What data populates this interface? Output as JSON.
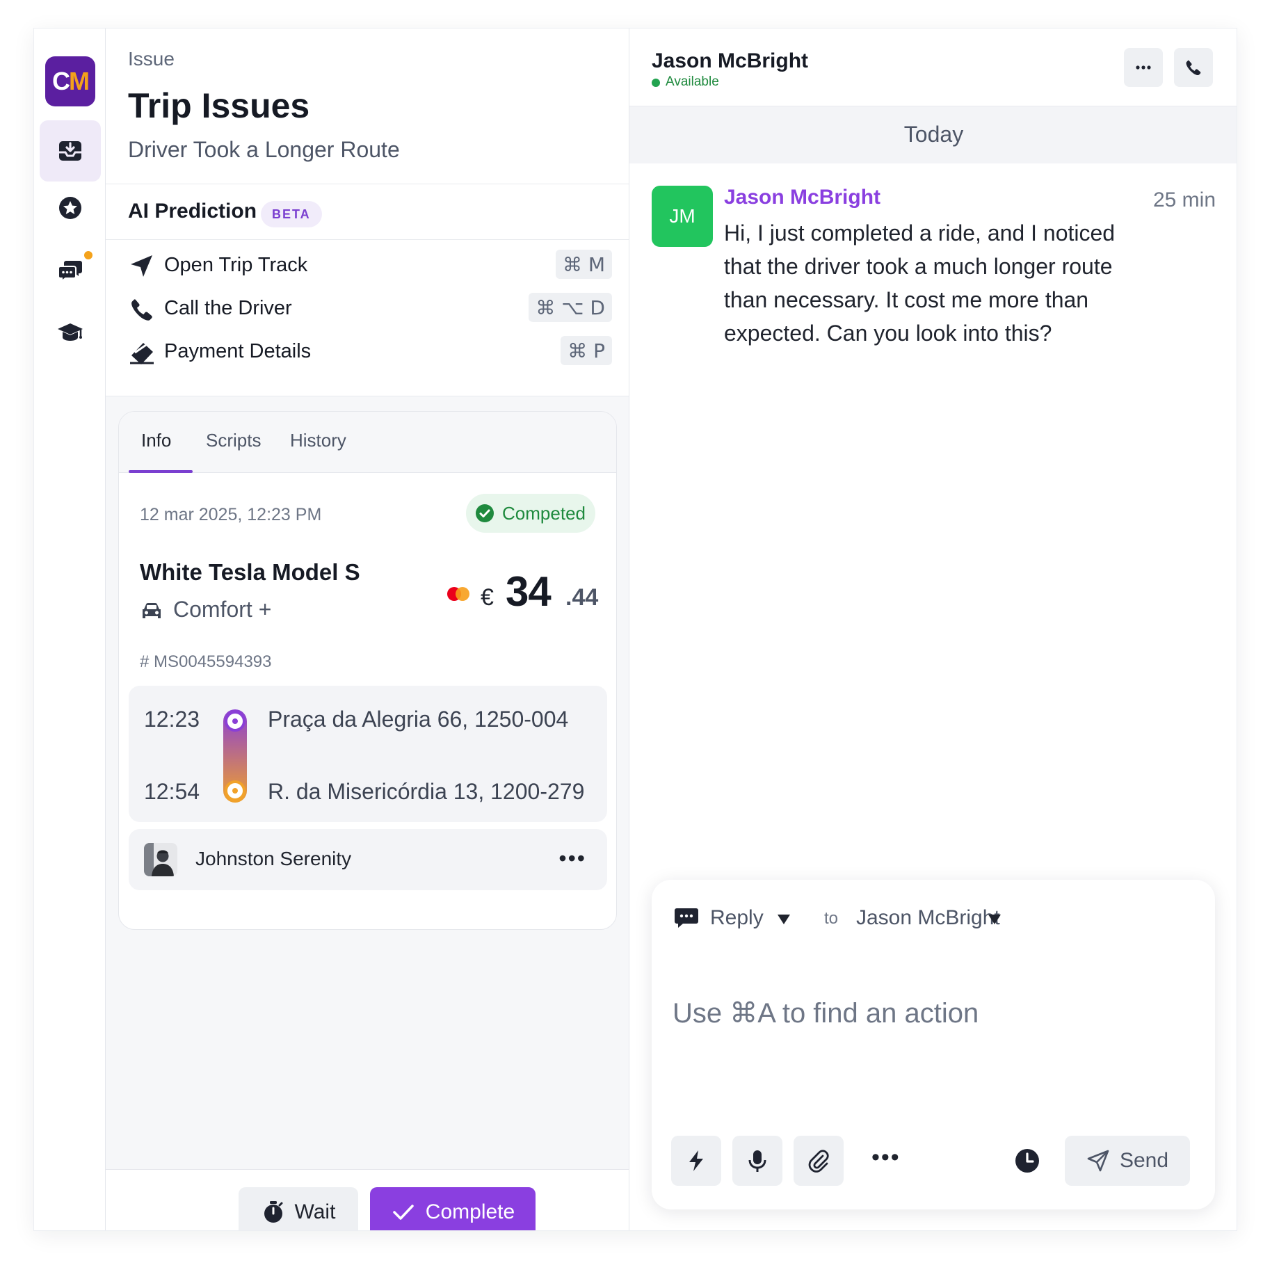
{
  "app": {
    "logo": {
      "letter_1": "C",
      "letter_2": "M"
    },
    "colors": {
      "brand": "#5b1fa0",
      "logo_accent": "#f4a21b",
      "accent": "#8a3fe0",
      "success": "#22c55e"
    }
  },
  "sidebar": {
    "items": [
      {
        "icon": "inbox-icon",
        "active": true
      },
      {
        "icon": "star-badge-icon",
        "active": false
      },
      {
        "icon": "chat-bubbles-icon",
        "active": false,
        "has_notification": true
      },
      {
        "icon": "graduation-cap-icon",
        "active": false
      }
    ]
  },
  "issue": {
    "kicker": "Issue",
    "title": "Trip Issues",
    "subtitle": "Driver Took a Longer Route"
  },
  "ai_prediction": {
    "title": "AI Prediction",
    "badge": "BETA",
    "actions": [
      {
        "icon": "navigation-arrow-icon",
        "label": "Open Trip Track",
        "shortcut": "⌘ M"
      },
      {
        "icon": "phone-icon",
        "label": "Call the Driver",
        "shortcut": "⌘ ⌥ D"
      },
      {
        "icon": "credit-card-icon",
        "label": "Payment Details",
        "shortcut": "⌘ P"
      }
    ]
  },
  "tabs": [
    "Info",
    "Scripts",
    "History"
  ],
  "active_tab": "Info",
  "ride": {
    "date": "12 mar 2025, 12:23 PM",
    "status": "Competed",
    "vehicle": "White Tesla Model S",
    "class": "Comfort +",
    "payment_icon": "mastercard-icon",
    "currency": "€",
    "price_main": "34",
    "price_cents": ".44",
    "trip_id": "# MS0045594393",
    "pickup": {
      "time": "12:23",
      "address": "Praça da Alegria 66, 1250-004"
    },
    "dropoff": {
      "time": "12:54",
      "address": "R. da Misericórdia 13, 1200-279"
    },
    "driver": {
      "name": "Johnston Serenity",
      "more": "•••"
    }
  },
  "footer": {
    "wait_label": "Wait",
    "complete_label": "Complete"
  },
  "chat": {
    "contact_name": "Jason McBright",
    "presence": "Available",
    "day_label": "Today",
    "messages": [
      {
        "initials": "JM",
        "author": "Jason McBright",
        "time": "25 min",
        "text": "Hi, I just completed a ride, and I noticed that the driver took a much longer route than necessary. It cost me more than expected. Can you look into this?"
      }
    ]
  },
  "composer": {
    "mode": "Reply",
    "to_label": "to",
    "recipient": "Jason McBright",
    "placeholder": "Use ⌘A to find an action",
    "more": "•••",
    "send_label": "Send"
  }
}
